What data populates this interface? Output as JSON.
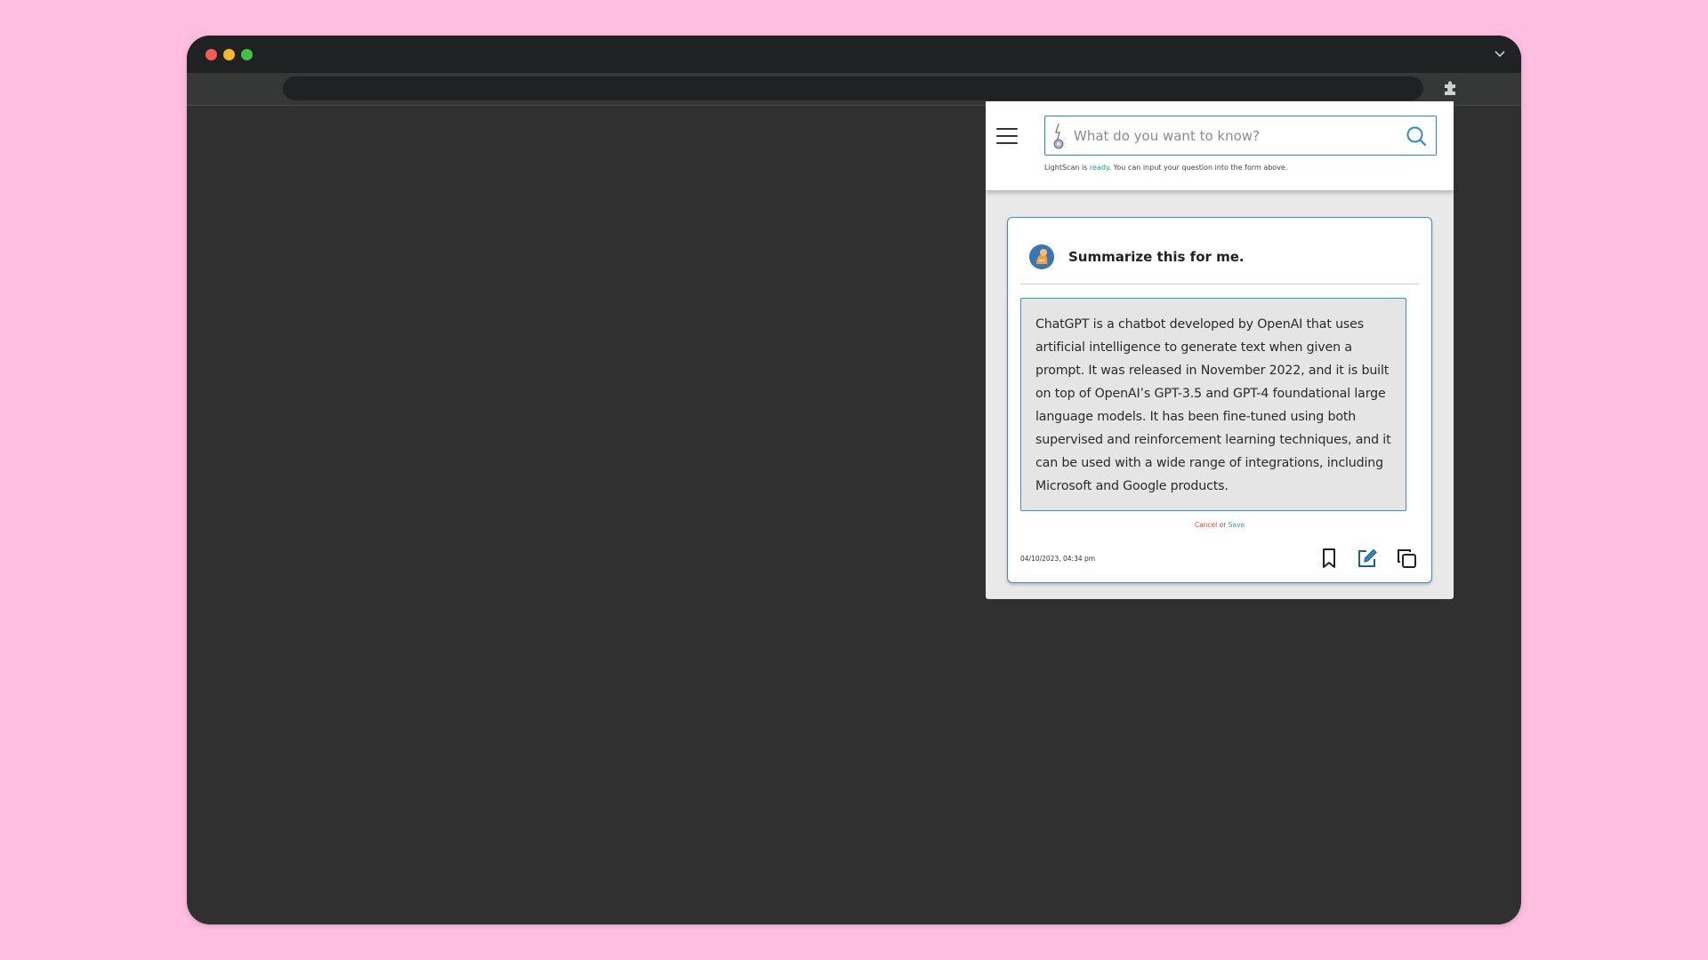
{
  "search": {
    "placeholder": "What do you want to know?"
  },
  "status": {
    "prefix": "LightScan is ",
    "ready": "ready",
    "suffix": ". You can input your question into the form above."
  },
  "card": {
    "question": "Summarize this for me.",
    "answer": "ChatGPT is a chatbot developed by OpenAI that uses artificial intelligence to generate text when given a prompt. It was released in November 2022, and it is built on top of OpenAI’s GPT-3.5 and GPT-4 foundational large language models. It has been fine-tuned using both supervised and reinforcement learning techniques, and it can be used with a wide range of integrations, including Microsoft and Google products.",
    "cancel_label": "Cancel",
    "or_label": "or",
    "save_label": "Save",
    "timestamp": "04/10/2023, 04:34 pm"
  },
  "icons": {
    "menu": "hamburger-menu-icon",
    "logo": "lightscan-logo-icon",
    "search": "search-icon",
    "avatar": "user-avatar-icon",
    "bookmark": "bookmark-icon",
    "edit": "edit-icon",
    "copy": "copy-icon",
    "extension": "puzzle-extension-icon",
    "window_menu": "chevron-down-icon"
  },
  "colors": {
    "accent": "#3d8fce",
    "ready": "#1ba28c",
    "cancel": "#d94a2f",
    "background": "#ffbde0",
    "browser_content": "#2f302f"
  }
}
